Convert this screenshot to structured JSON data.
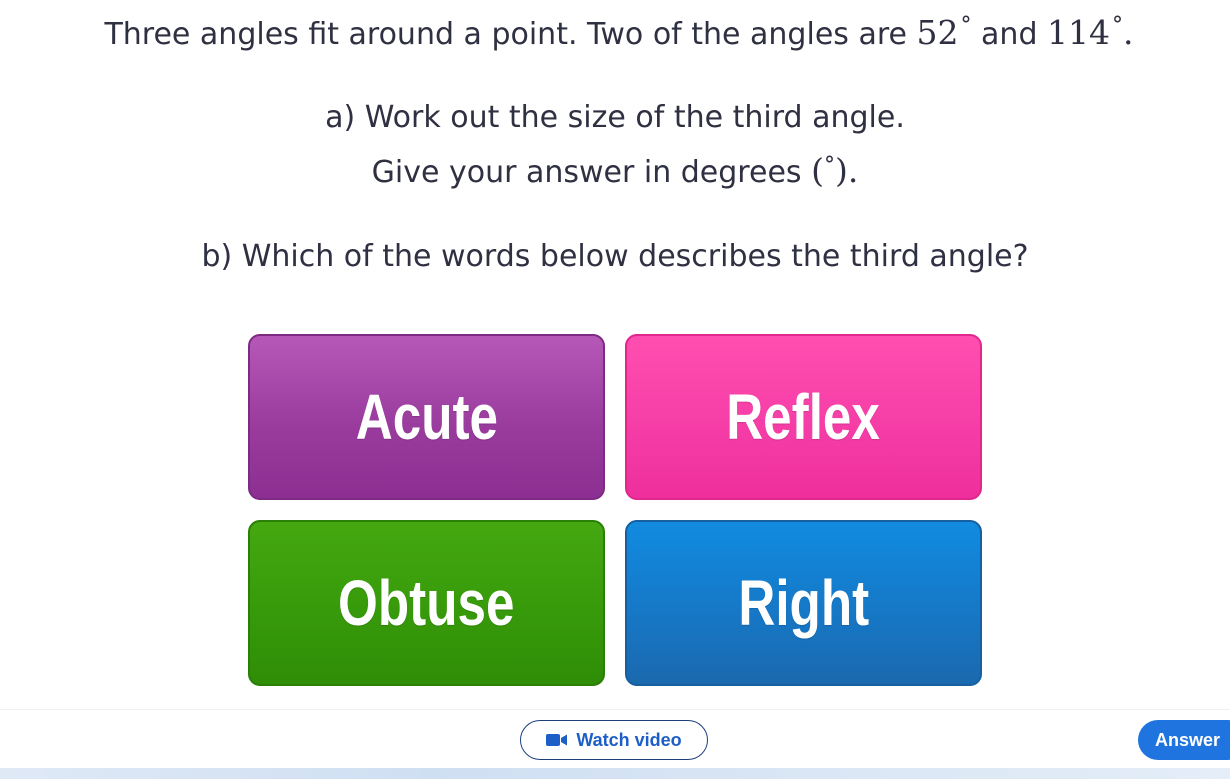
{
  "question": {
    "intro_text": "Three angles fit around a point. Two of the angles are",
    "angle1_value": "52",
    "and_text": "and",
    "angle2_value": "114",
    "degree_symbol": "°",
    "end_period": ".",
    "part_a_line1": "a) Work out the size of the third angle.",
    "part_a_line2": "Give your answer in degrees",
    "open_paren": "(",
    "close_paren_period": ").",
    "part_b": "b) Which of the words below describes the third angle?"
  },
  "options": {
    "acute": "Acute",
    "reflex": "Reflex",
    "obtuse": "Obtuse",
    "right": "Right"
  },
  "footer": {
    "watch_video_label": "Watch video",
    "answer_label": "Answer",
    "watch_icon": "video-camera-icon"
  },
  "colors": {
    "acute": "#9a3c9e",
    "reflex": "#f53ca6",
    "obtuse": "#379a0a",
    "right": "#1678c7",
    "answer_button": "#1f74df",
    "link_blue": "#1d5fc6"
  }
}
